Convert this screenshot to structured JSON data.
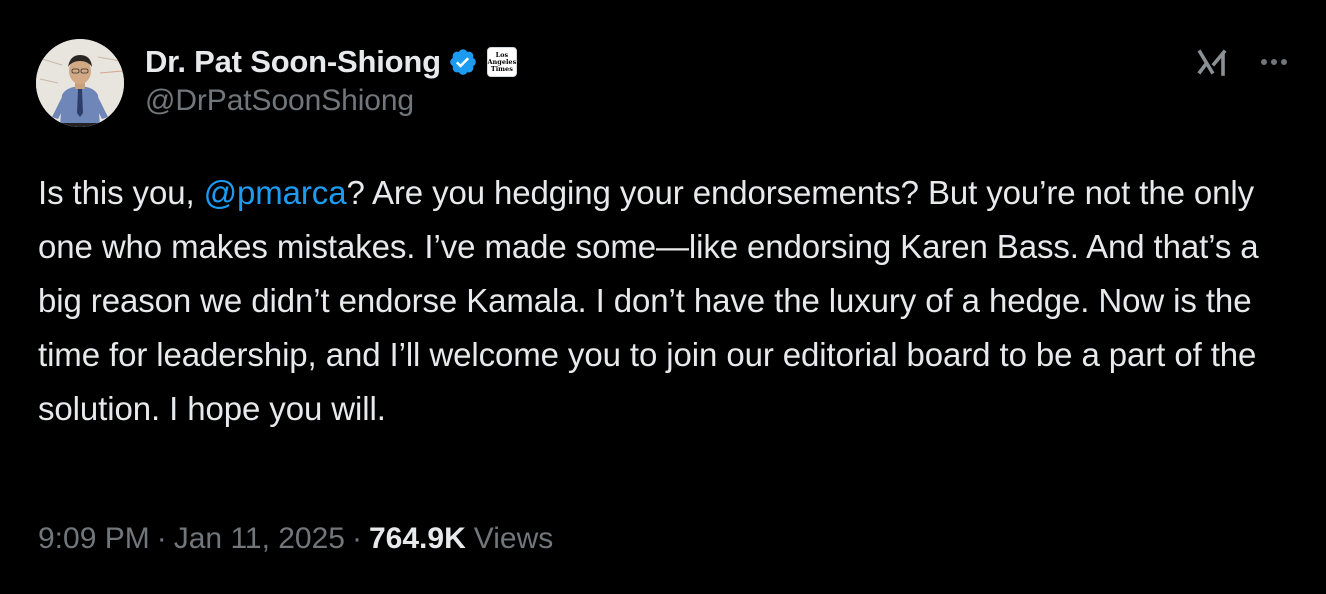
{
  "author": {
    "display_name": "Dr. Pat Soon-Shiong",
    "handle": "@DrPatSoonShiong",
    "affiliate_badge_text": "Los\nAngeles\nTimes"
  },
  "tweet": {
    "text_before_mention": "Is this you, ",
    "mention": "@pmarca",
    "text_after_mention": "? Are you hedging your endorsements? But you’re not the only one who makes mistakes. I’ve made some—like endorsing Karen Bass. And that’s a big reason we didn’t endorse Kamala. I don’t have the luxury of a hedge. Now is the time for leadership, and I’ll welcome you to join our editorial board to be a part of the solution. I hope you will."
  },
  "meta": {
    "time": "9:09 PM",
    "separator": "·",
    "date": "Jan 11, 2025",
    "views_count": "764.9K",
    "views_label": "Views"
  },
  "icons": {
    "verified": "verified-badge-icon",
    "grok": "grok-icon",
    "more": "more-options-icon"
  },
  "colors": {
    "background": "#000000",
    "text": "#e7e9ea",
    "secondary_text": "#71767b",
    "link": "#1d9bf0",
    "verified": "#1d9bf0"
  }
}
